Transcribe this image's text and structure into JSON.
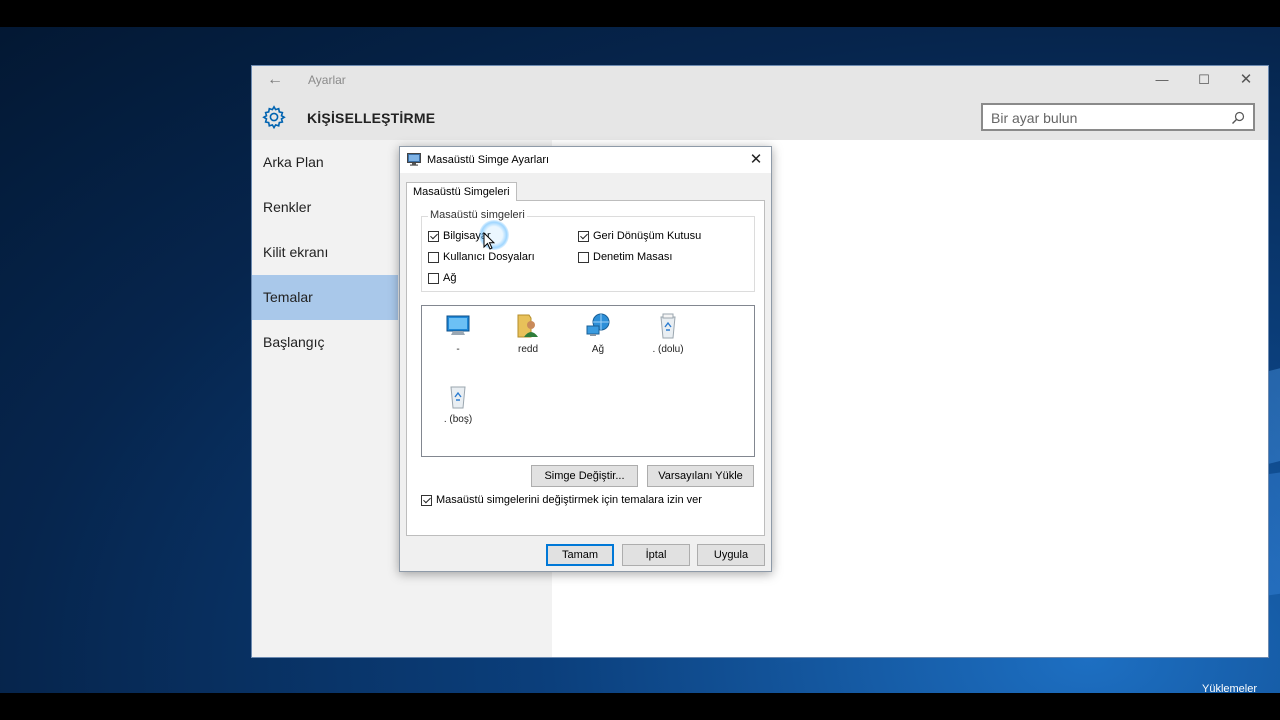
{
  "settings_window": {
    "app_title": "Ayarlar",
    "back_icon": "arrow-left-icon",
    "header_title": "KİŞİSELLEŞTİRME",
    "header_icon": "gear-icon",
    "search": {
      "placeholder": "Bir ayar bulun",
      "icon": "search-icon"
    },
    "window_controls": {
      "minimize": "—",
      "maximize": "☐",
      "close": "✕"
    },
    "sidebar": {
      "items": [
        {
          "label": "Arka Plan",
          "active": false
        },
        {
          "label": "Renkler",
          "active": false
        },
        {
          "label": "Kilit ekranı",
          "active": false
        },
        {
          "label": "Temalar",
          "active": true
        },
        {
          "label": "Başlangıç",
          "active": false
        }
      ]
    }
  },
  "dialog": {
    "title": "Masaüstü Simge Ayarları",
    "close_label": "✕",
    "tab_label": "Masaüstü Simgeleri",
    "group_label": "Masaüstü simgeleri",
    "checkboxes": [
      {
        "label": "Bilgisayar",
        "checked": true
      },
      {
        "label": "Geri Dönüşüm Kutusu",
        "checked": true
      },
      {
        "label": "Kullanıcı Dosyaları",
        "checked": false
      },
      {
        "label": "Denetim Masası",
        "checked": false
      },
      {
        "label": "Ağ",
        "checked": false
      }
    ],
    "icons": [
      {
        "label": "-",
        "icon": "computer-icon"
      },
      {
        "label": "redd",
        "icon": "user-folder-icon"
      },
      {
        "label": "Ağ",
        "icon": "network-icon"
      },
      {
        "label": ". (dolu)",
        "icon": "recycle-bin-full-icon"
      },
      {
        "label": ". (boş)",
        "icon": "recycle-bin-empty-icon"
      }
    ],
    "change_icon_button": "Simge Değiştir...",
    "restore_default_button": "Varsayılanı Yükle",
    "allow_themes": {
      "label": "Masaüstü simgelerini değiştirmek için temalara izin ver",
      "checked": true
    },
    "ok_button": "Tamam",
    "cancel_button": "İptal",
    "apply_button": "Uygula"
  },
  "desktop": {
    "corner_label": "Yüklemeler"
  },
  "colors": {
    "accent": "#0078d7",
    "sidebar_active": "#a9c8ea",
    "title_bar": "#e6e6e6"
  }
}
